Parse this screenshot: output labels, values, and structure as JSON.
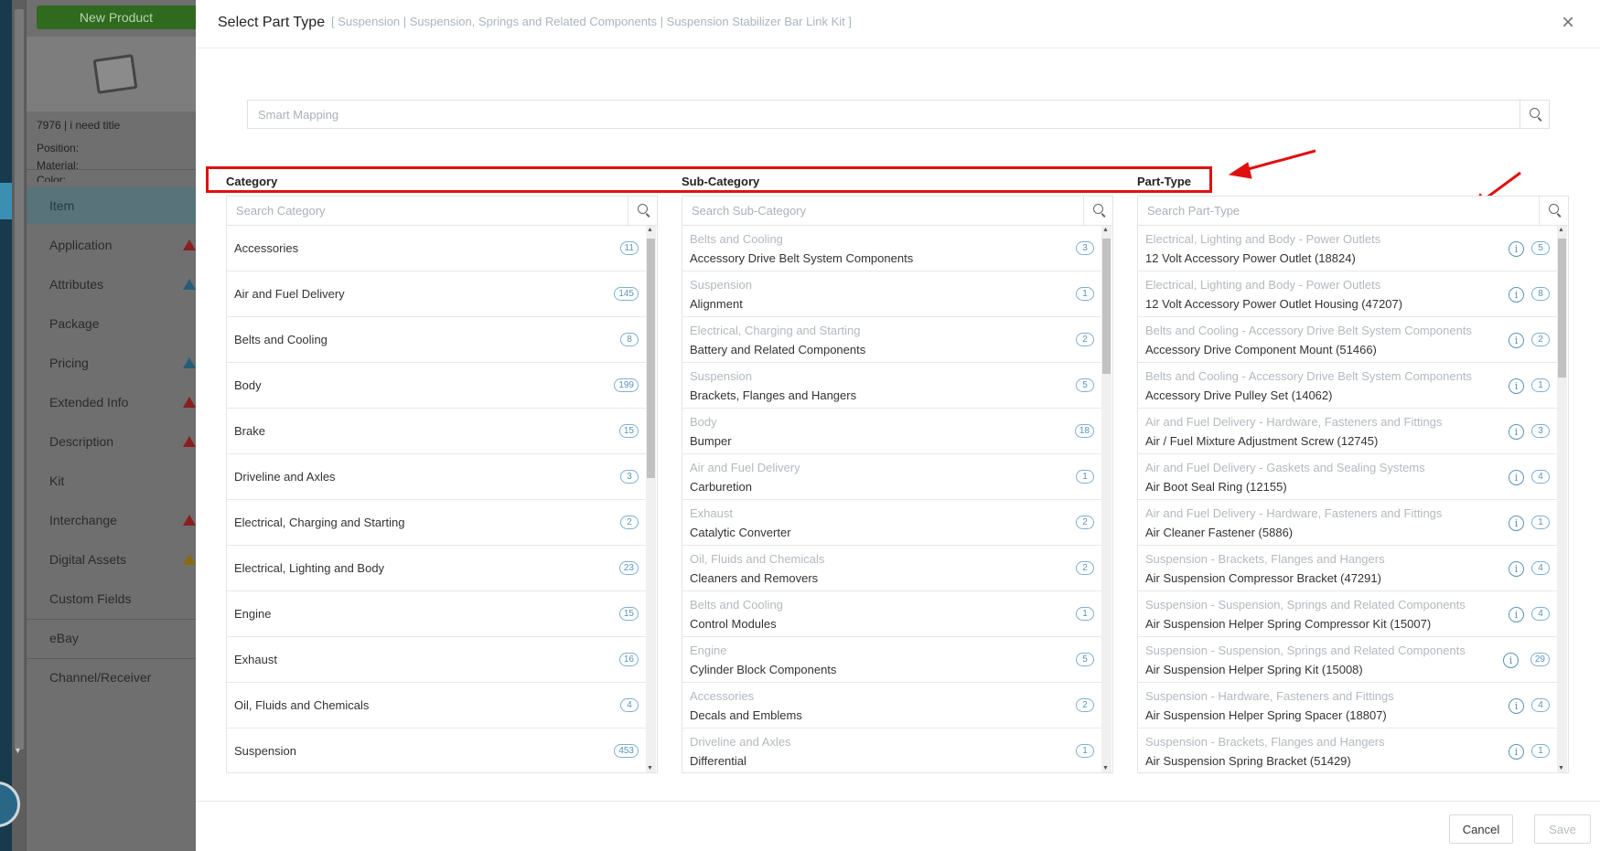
{
  "background": {
    "new_product_label": "New Product",
    "no_image_caption": "NO IMAGE",
    "product_title": "7976 | i need title",
    "fields": [
      "Position:",
      "Material:",
      "Color:"
    ],
    "nav": [
      {
        "label": "Item",
        "warn": ""
      },
      {
        "label": "Application",
        "warn": "red"
      },
      {
        "label": "Attributes",
        "warn": "blue"
      },
      {
        "label": "Package",
        "warn": ""
      },
      {
        "label": "Pricing",
        "warn": "blue"
      },
      {
        "label": "Extended Info",
        "warn": "red"
      },
      {
        "label": "Description",
        "warn": "red"
      },
      {
        "label": "Kit",
        "warn": ""
      },
      {
        "label": "Interchange",
        "warn": "red"
      },
      {
        "label": "Digital Assets",
        "warn": "orange"
      },
      {
        "label": "Custom Fields",
        "warn": ""
      },
      {
        "label": "eBay",
        "warn": ""
      },
      {
        "label": "Channel/Receiver",
        "warn": ""
      }
    ]
  },
  "modal": {
    "title": "Select Part Type",
    "breadcrumb": "[ Suspension | Suspension, Springs and Related Components | Suspension Stabilizer Bar Link Kit ]",
    "smart_mapping_placeholder": "Smart Mapping",
    "headers": {
      "category": "Category",
      "subcategory": "Sub-Category",
      "parttype": "Part-Type"
    },
    "search_placeholders": {
      "category": "Search Category",
      "subcategory": "Search Sub-Category",
      "parttype": "Search Part-Type"
    },
    "categories": [
      {
        "name": "Accessories",
        "count": "11"
      },
      {
        "name": "Air and Fuel Delivery",
        "count": "145"
      },
      {
        "name": "Belts and Cooling",
        "count": "8"
      },
      {
        "name": "Body",
        "count": "199"
      },
      {
        "name": "Brake",
        "count": "15"
      },
      {
        "name": "Driveline and Axles",
        "count": "3"
      },
      {
        "name": "Electrical, Charging and Starting",
        "count": "2"
      },
      {
        "name": "Electrical, Lighting and Body",
        "count": "23"
      },
      {
        "name": "Engine",
        "count": "15"
      },
      {
        "name": "Exhaust",
        "count": "16"
      },
      {
        "name": "Oil, Fluids and Chemicals",
        "count": "4"
      },
      {
        "name": "Suspension",
        "count": "453"
      }
    ],
    "subcategories": [
      {
        "parent": "Belts and Cooling",
        "name": "Accessory Drive Belt System Components",
        "count": "3"
      },
      {
        "parent": "Suspension",
        "name": "Alignment",
        "count": "1"
      },
      {
        "parent": "Electrical, Charging and Starting",
        "name": "Battery and Related Components",
        "count": "2"
      },
      {
        "parent": "Suspension",
        "name": "Brackets, Flanges and Hangers",
        "count": "5"
      },
      {
        "parent": "Body",
        "name": "Bumper",
        "count": "18"
      },
      {
        "parent": "Air and Fuel Delivery",
        "name": "Carburetion",
        "count": "1"
      },
      {
        "parent": "Exhaust",
        "name": "Catalytic Converter",
        "count": "2"
      },
      {
        "parent": "Oil, Fluids and Chemicals",
        "name": "Cleaners and Removers",
        "count": "2"
      },
      {
        "parent": "Belts and Cooling",
        "name": "Control Modules",
        "count": "1"
      },
      {
        "parent": "Engine",
        "name": "Cylinder Block Components",
        "count": "5"
      },
      {
        "parent": "Accessories",
        "name": "Decals and Emblems",
        "count": "2"
      },
      {
        "parent": "Driveline and Axles",
        "name": "Differential",
        "count": "1"
      }
    ],
    "parttypes": [
      {
        "parent": "Electrical, Lighting and Body - Power Outlets",
        "name": "12 Volt Accessory Power Outlet (18824)",
        "count": "5"
      },
      {
        "parent": "Electrical, Lighting and Body - Power Outlets",
        "name": "12 Volt Accessory Power Outlet Housing (47207)",
        "count": "8"
      },
      {
        "parent": "Belts and Cooling - Accessory Drive Belt System Components",
        "name": "Accessory Drive Component Mount (51466)",
        "count": "2"
      },
      {
        "parent": "Belts and Cooling - Accessory Drive Belt System Components",
        "name": "Accessory Drive Pulley Set (14062)",
        "count": "1"
      },
      {
        "parent": "Air and Fuel Delivery - Hardware, Fasteners and Fittings",
        "name": "Air / Fuel Mixture Adjustment Screw (12745)",
        "count": "3"
      },
      {
        "parent": "Air and Fuel Delivery - Gaskets and Sealing Systems",
        "name": "Air Boot Seal Ring (12155)",
        "count": "4"
      },
      {
        "parent": "Air and Fuel Delivery - Hardware, Fasteners and Fittings",
        "name": "Air Cleaner Fastener (5886)",
        "count": "1"
      },
      {
        "parent": "Suspension - Brackets, Flanges and Hangers",
        "name": "Air Suspension Compressor Bracket (47291)",
        "count": "4"
      },
      {
        "parent": "Suspension - Suspension, Springs and Related Components",
        "name": "Air Suspension Helper Spring Compressor Kit (15007)",
        "count": "4"
      },
      {
        "parent": "Suspension - Suspension, Springs and Related Components",
        "name": "Air Suspension Helper Spring Kit (15008)",
        "count": "29"
      },
      {
        "parent": "Suspension - Hardware, Fasteners and Fittings",
        "name": "Air Suspension Helper Spring Spacer (18807)",
        "count": "4"
      },
      {
        "parent": "Suspension - Brackets, Flanges and Hangers",
        "name": "Air Suspension Spring Bracket (51429)",
        "count": "1"
      }
    ],
    "info_glyph": "i",
    "close_glyph": "×",
    "cancel_label": "Cancel",
    "save_label": "Save"
  },
  "colors": {
    "highlight": "#e01010",
    "badge": "#5a93b8",
    "sidebar_active": "#587379"
  }
}
